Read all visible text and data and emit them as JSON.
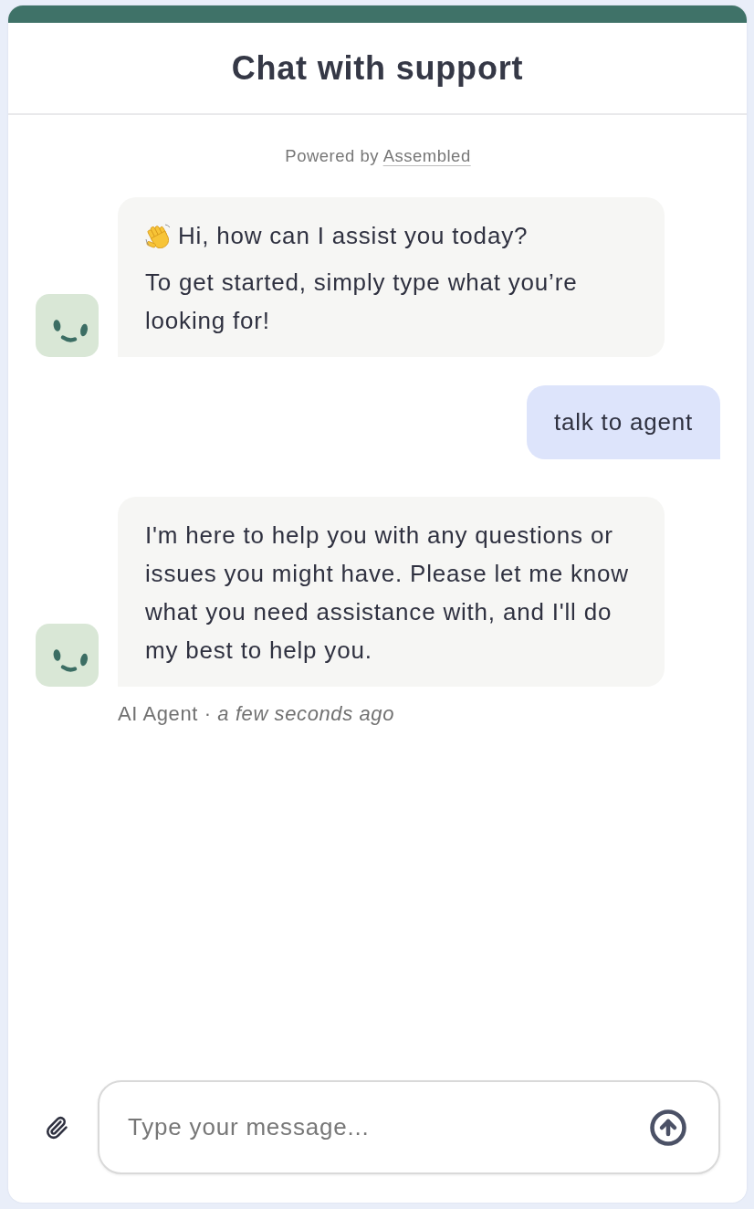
{
  "header": {
    "title": "Chat with support"
  },
  "powered_by": {
    "text": "Powered by",
    "link": "Assembled"
  },
  "messages": [
    {
      "kind": "bot",
      "paragraphs": [
        {
          "kind": "greeting",
          "text": "Hi, how can I assist you today?"
        },
        {
          "kind": "plain",
          "text": "To get started, simply type what you’re looking for!"
        }
      ]
    },
    {
      "kind": "user",
      "paragraphs": [
        {
          "kind": "plain",
          "text": "talk to agent"
        }
      ]
    },
    {
      "kind": "bot",
      "paragraphs": [
        {
          "kind": "plain",
          "text": "I'm here to help you with any questions or issues you might have. Please let me know what you need assistance with, and I'll do my best to help you."
        }
      ],
      "meta": "AI Agent · *a few seconds ago*"
    }
  ],
  "composer": {
    "placeholder": "Type your message..."
  }
}
